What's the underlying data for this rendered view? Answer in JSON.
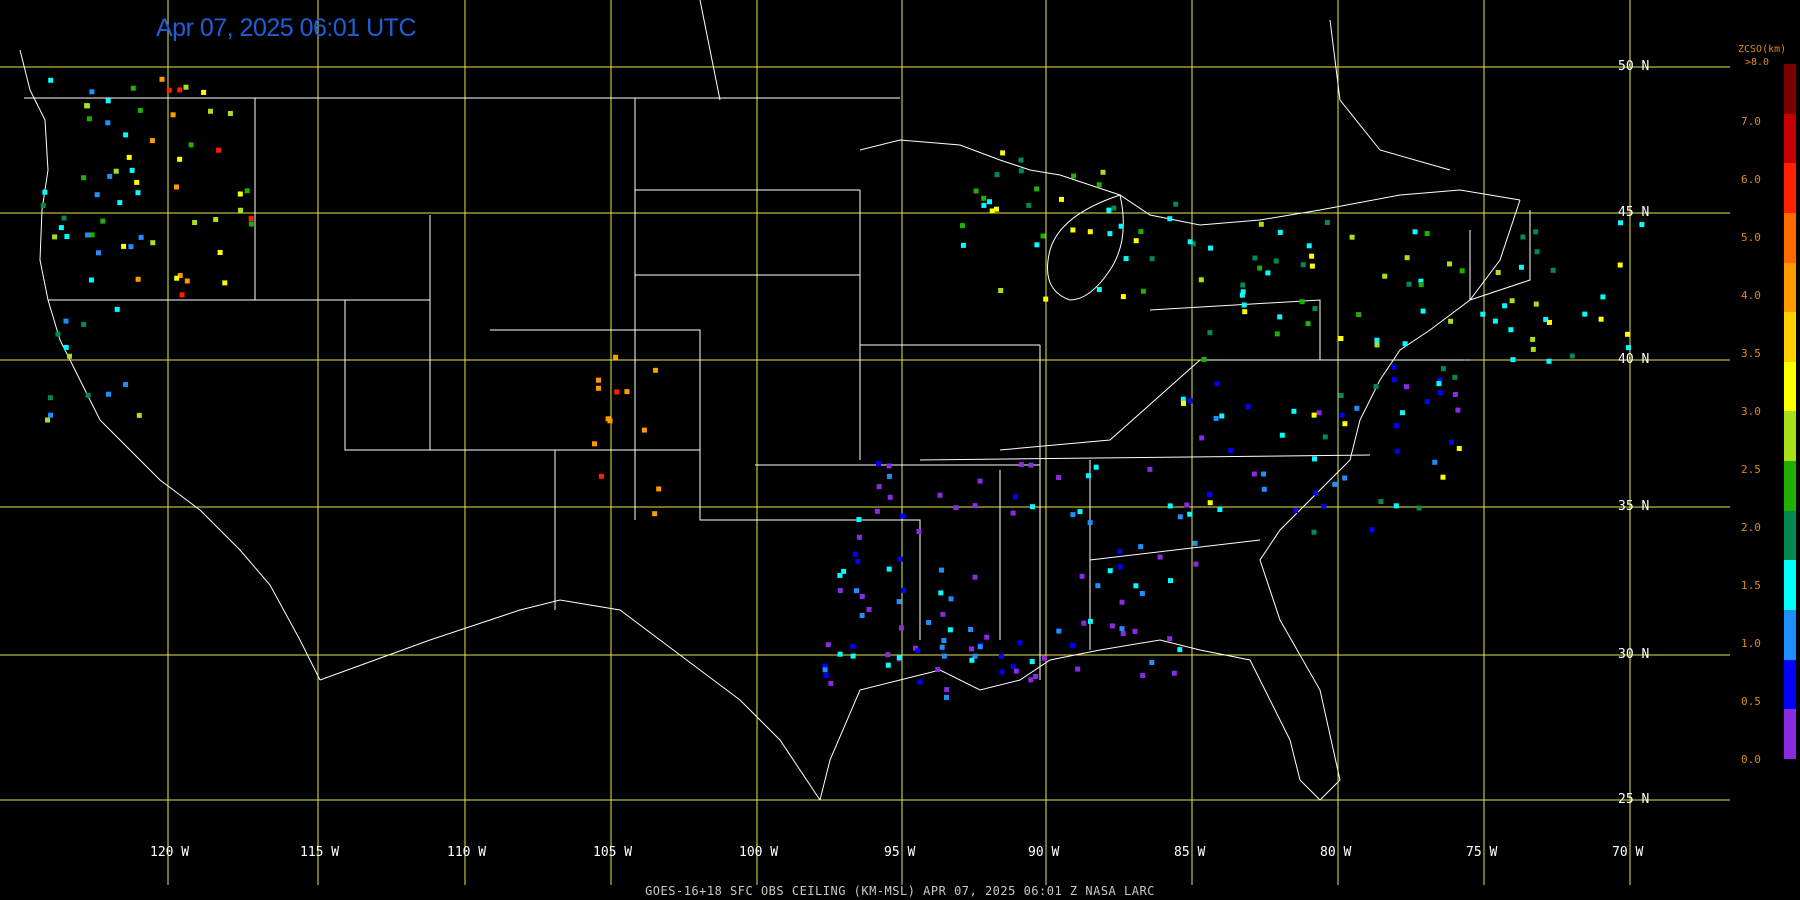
{
  "title": "Apr 07, 2025 06:01 UTC",
  "footer": "GOES-16+18  SFC OBS CEILING (KM-MSL)   APR 07, 2025 06:01 Z   NASA LARC",
  "legend": {
    "title": "ZCSO(km)",
    "top_label": ">8.0",
    "labels": [
      "7.0",
      "6.0",
      "5.0",
      "4.0",
      "3.5",
      "3.0",
      "2.5",
      "2.0",
      "1.5",
      "1.0",
      "0.5",
      "0.0"
    ],
    "colors": [
      "#7a0000",
      "#c40000",
      "#ff2000",
      "#ff6a00",
      "#ff9a00",
      "#ffd000",
      "#ffff00",
      "#a8e01e",
      "#1fb000",
      "#008a50",
      "#00ffff",
      "#1f8fff",
      "#0000ff",
      "#8a2be2"
    ]
  },
  "lat_labels": [
    "50 N",
    "45 N",
    "40 N",
    "35 N",
    "30 N",
    "25 N"
  ],
  "lon_labels": [
    "120 W",
    "115 W",
    "110 W",
    "105 W",
    "100 W",
    "95 W",
    "90 W",
    "85 W",
    "80 W",
    "75 W",
    "70 W"
  ],
  "grid_color": "#e6e64a"
}
